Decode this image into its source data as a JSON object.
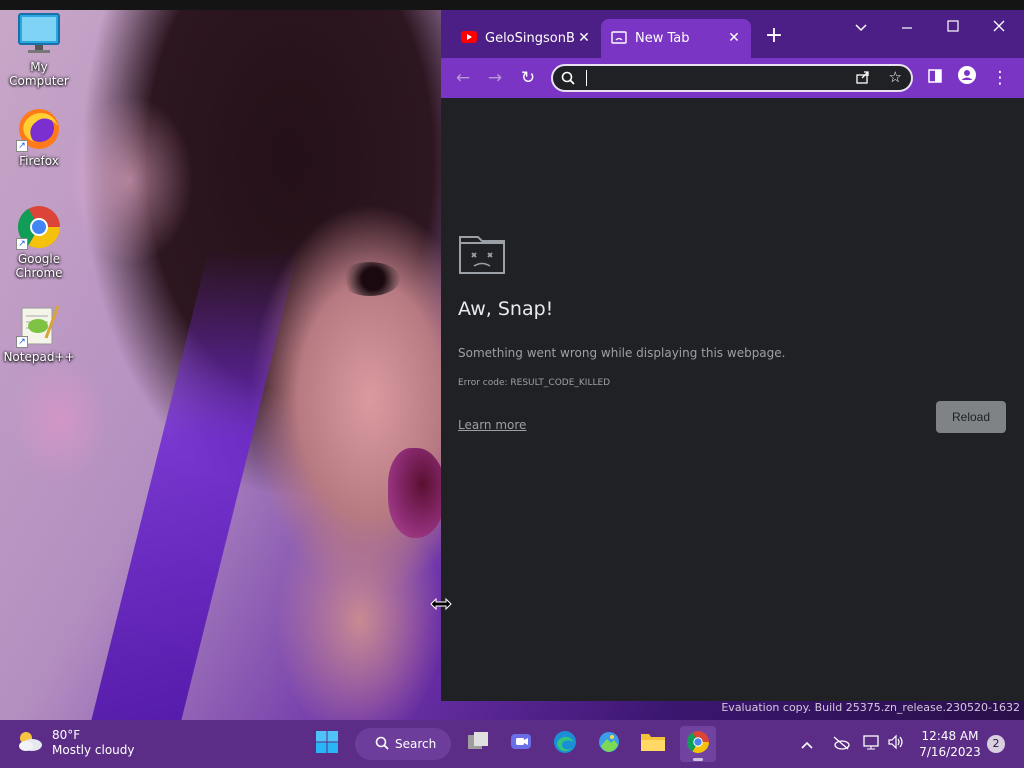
{
  "desktop": {
    "icons": [
      {
        "label": "My Computer",
        "icon": "monitor-icon"
      },
      {
        "label": "Firefox",
        "icon": "firefox-icon"
      },
      {
        "label": "Google Chrome",
        "icon": "chrome-icon"
      },
      {
        "label": "Notepad++",
        "icon": "notepad-plus-plus-icon"
      }
    ],
    "watermark": "Evaluation copy. Build 25375.zn_release.230520-1632"
  },
  "browser": {
    "tabs": [
      {
        "title": "GeloSingsonBSC",
        "icon": "youtube-icon",
        "active": false
      },
      {
        "title": "New Tab",
        "icon": "sad-tab-icon",
        "active": true
      }
    ],
    "window_controls": [
      "chevron-down-icon",
      "minimize-icon",
      "maximize-icon",
      "close-icon"
    ],
    "omnibox": {
      "value": "",
      "placeholder": ""
    },
    "error_page": {
      "title": "Aw, Snap!",
      "message": "Something went wrong while displaying this webpage.",
      "error_code": "Error code: RESULT_CODE_KILLED",
      "learn_more": "Learn more",
      "reload": "Reload"
    },
    "colors": {
      "accent": "#7b35c4",
      "tabstrip": "#4c1f86",
      "page_bg": "#202124"
    }
  },
  "taskbar": {
    "weather": {
      "temp": "80°F",
      "condition": "Mostly cloudy"
    },
    "search_label": "Search",
    "apps": [
      "windows-start-icon",
      "search-icon",
      "task-view-icon",
      "meet-icon",
      "edge-icon",
      "photos-icon",
      "file-explorer-icon",
      "chrome-icon"
    ],
    "clock": {
      "time": "12:48 AM",
      "date": "7/16/2023"
    },
    "notifications": "2",
    "color": "#5b2d87"
  }
}
